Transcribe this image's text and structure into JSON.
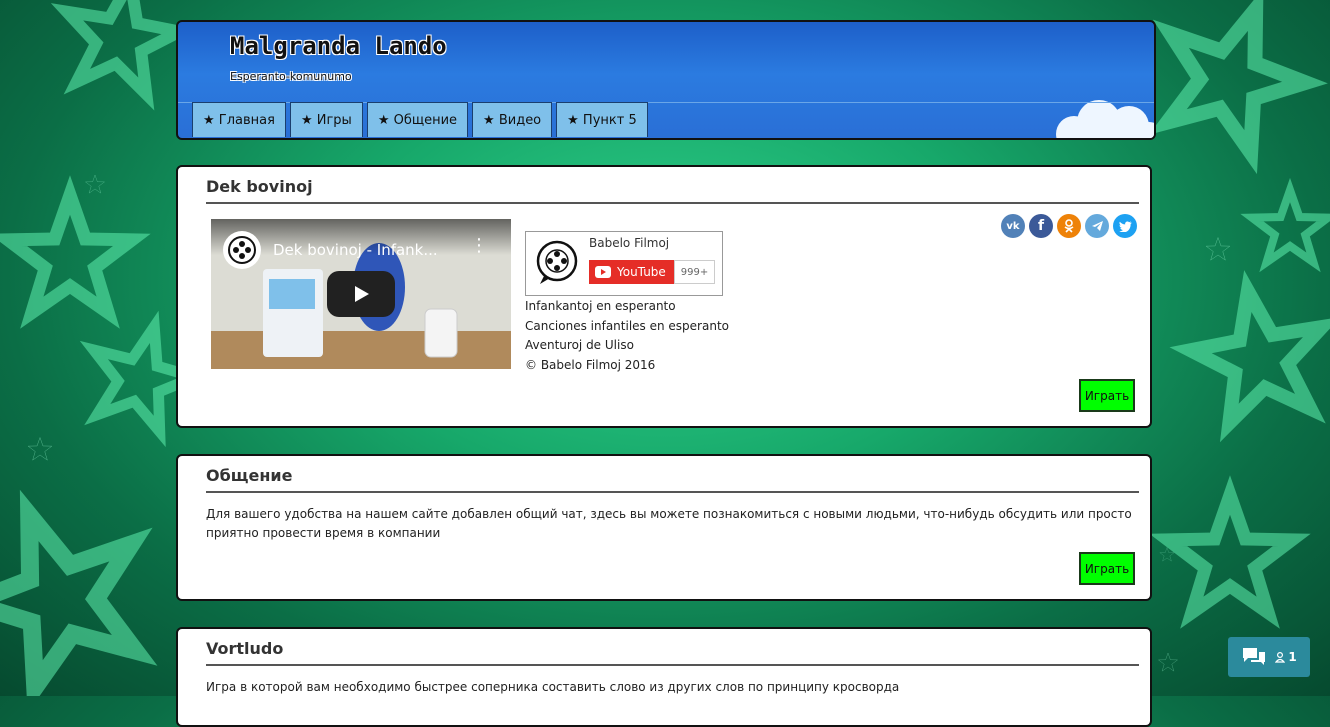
{
  "header": {
    "title": "Malgranda Lando",
    "subtitle": "Esperanto-komunumo",
    "nav": [
      {
        "label": "★ Главная"
      },
      {
        "label": "★ Игры"
      },
      {
        "label": "★ Общение"
      },
      {
        "label": "★ Видео"
      },
      {
        "label": "★ Пункт 5"
      }
    ]
  },
  "cards": [
    {
      "title": "Dek bovinoj",
      "video": {
        "title": "Dek bovinoj - Infank..."
      },
      "channel": {
        "name": "Babelo Filmoj",
        "youtube_label": "YouTube",
        "subscribers": "999+"
      },
      "description": [
        "Infankantoj en esperanto",
        "Canciones infantiles en esperanto",
        "Aventuroj de Uliso",
        "© Babelo Filmoj 2016"
      ],
      "share": [
        {
          "name": "vk",
          "color": "#5181b8"
        },
        {
          "name": "facebook",
          "color": "#3b5998"
        },
        {
          "name": "odnoklassniki",
          "color": "#ee8208"
        },
        {
          "name": "telegram",
          "color": "#64a9dc"
        },
        {
          "name": "twitter",
          "color": "#1da1f2"
        }
      ],
      "button": "Играть"
    },
    {
      "title": "Общение",
      "text": "Для вашего удобства на нашем сайте добавлен общий чат, здесь вы можете познакомиться с новыми людьми, что-нибудь обсудить или просто приятно провести время в компании",
      "button": "Играть"
    },
    {
      "title": "Vortludo",
      "text": "Игра в которой вам необходимо быстрее соперника составить слово из других слов по принципу кросворда"
    }
  ],
  "chat_widget": {
    "online_count": "1"
  },
  "colors": {
    "accent_button": "#00ff00",
    "header_blue": "#2b7be0",
    "nav_item": "#7fc0ea",
    "chat_widget": "#2b8a9c"
  }
}
